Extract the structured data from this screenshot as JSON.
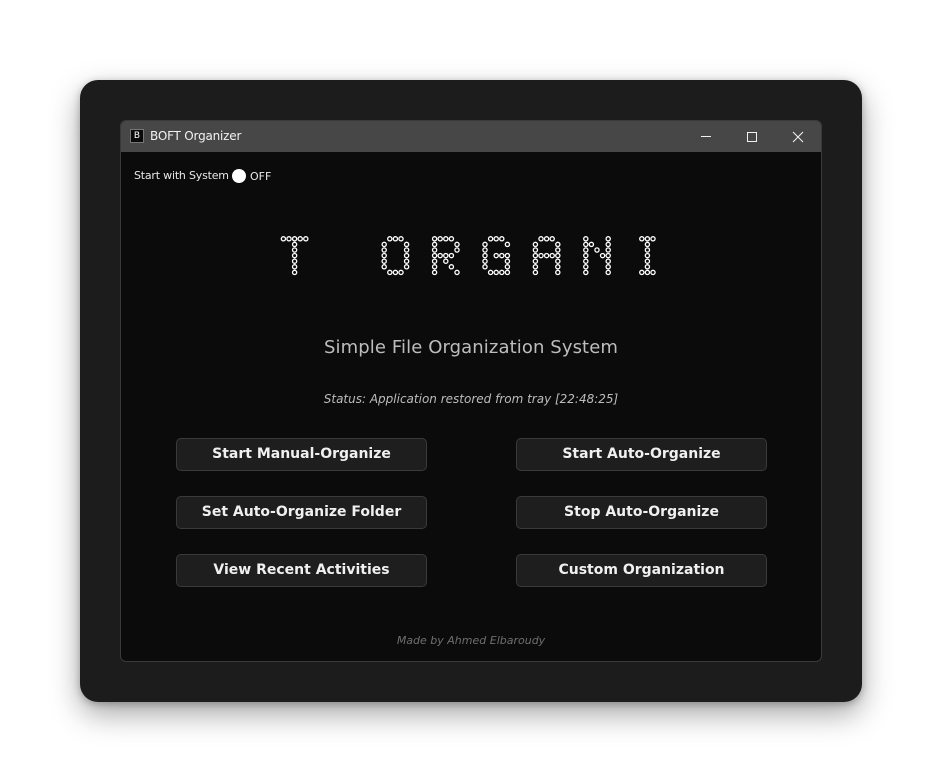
{
  "window": {
    "title": "BOFT Organizer",
    "icon_letter": "B",
    "controls": {
      "minimize_icon": "minimize-icon",
      "maximize_icon": "maximize-icon",
      "close_icon": "close-icon"
    }
  },
  "startup": {
    "label": "Start with System",
    "toggle_state": "OFF"
  },
  "header": {
    "logo_text": "BOFT ORGANIZER",
    "subtitle": "Simple File Organization System"
  },
  "status": {
    "text": "Status: Application restored from tray [22:48:25]"
  },
  "buttons": {
    "start_manual": "Start Manual-Organize",
    "start_auto": "Start Auto-Organize",
    "set_folder": "Set Auto-Organize Folder",
    "stop_auto": "Stop Auto-Organize",
    "view_recent": "View Recent Activities",
    "custom_org": "Custom Organization"
  },
  "footer": {
    "credit": "Made by Ahmed Elbaroudy"
  },
  "colors": {
    "window_background": "#0b0b0b",
    "titlebar": "#474747",
    "button_background": "#1e1e1e",
    "logo_dots": "#ffffff",
    "outer_frame": "#1c1c1c"
  }
}
